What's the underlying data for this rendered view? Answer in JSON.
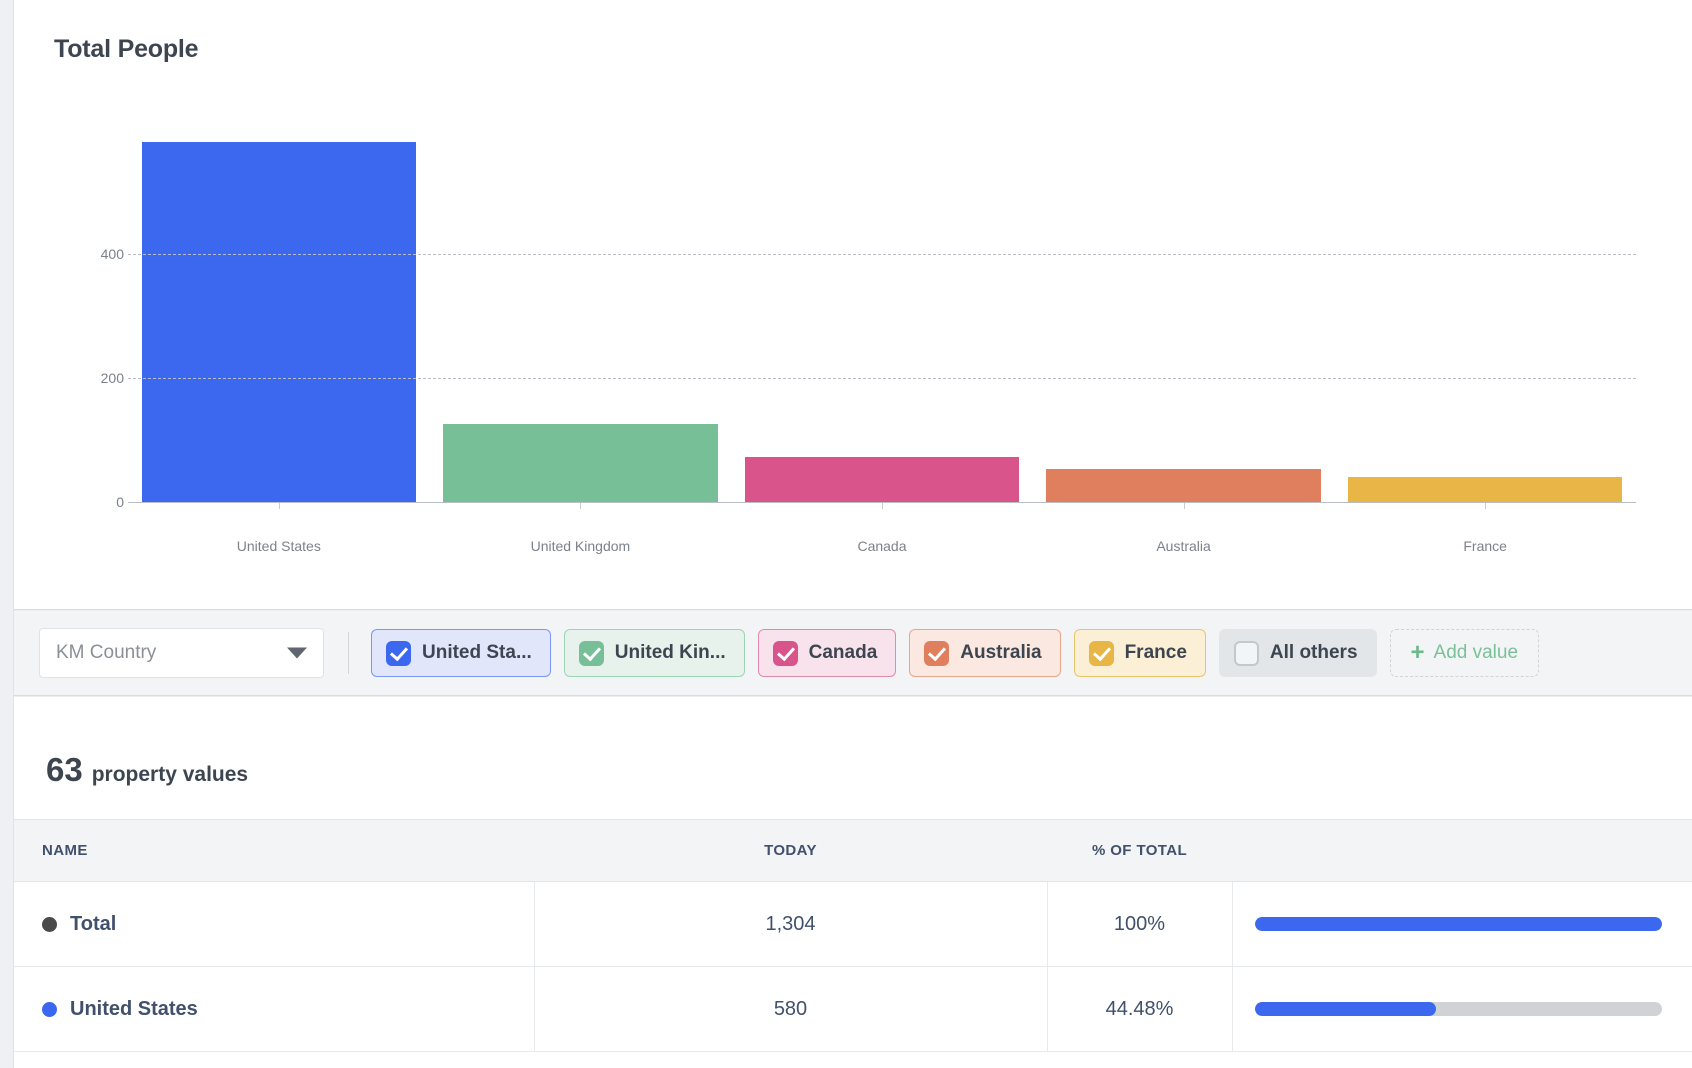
{
  "chart_card": {
    "title": "Total People"
  },
  "chart_data": {
    "type": "bar",
    "title": "Total People",
    "xlabel": "",
    "ylabel": "",
    "categories": [
      "United States",
      "United Kingdom",
      "Canada",
      "Australia",
      "France"
    ],
    "values": [
      580,
      126,
      73,
      54,
      40
    ],
    "colors": [
      "#3b68ef",
      "#77bf96",
      "#d9548a",
      "#e07f5e",
      "#e7b646"
    ],
    "yticks": [
      0,
      200,
      400
    ],
    "ylim": [
      0,
      600
    ],
    "grid": true,
    "legend": false
  },
  "filters": {
    "property_select": {
      "value": "KM Country",
      "icon": "chevron-down-icon"
    },
    "chips": [
      {
        "label": "United Sta...",
        "checked": true,
        "color": "#3b68ef",
        "bg": "#e2e6fb",
        "border": "#7b96f5"
      },
      {
        "label": "United Kin...",
        "checked": true,
        "color": "#77bf96",
        "bg": "#e6f2eb",
        "border": "#9fd3b6"
      },
      {
        "label": "Canada",
        "checked": true,
        "color": "#d9548a",
        "bg": "#f8e3ed",
        "border": "#e287ae"
      },
      {
        "label": "Australia",
        "checked": true,
        "color": "#e07f5e",
        "bg": "#fbe8e1",
        "border": "#eaa68c"
      },
      {
        "label": "France",
        "checked": true,
        "color": "#e7b646",
        "bg": "#fbefd5",
        "border": "#e9c470"
      },
      {
        "label": "All others",
        "checked": false,
        "color": "#c3c8cd",
        "bg": "#e3e6e8",
        "border": "#e3e6e8"
      }
    ],
    "add_value_label": "Add value",
    "add_value_icon": "plus-icon"
  },
  "summary": {
    "count": "63",
    "label": "property values"
  },
  "table": {
    "columns": [
      "NAME",
      "TODAY",
      "% OF TOTAL",
      ""
    ],
    "rows": [
      {
        "name": "Total",
        "dot_color": "#4a4a4a",
        "today": "1,304",
        "pct": "100%",
        "fill_pct": "100",
        "fill_color": "#3b68ef",
        "track_visible": false
      },
      {
        "name": "United States",
        "dot_color": "#3b68ef",
        "today": "580",
        "pct": "44.48%",
        "fill_pct": "44.48",
        "fill_color": "#3b68ef",
        "track_visible": true
      }
    ]
  }
}
